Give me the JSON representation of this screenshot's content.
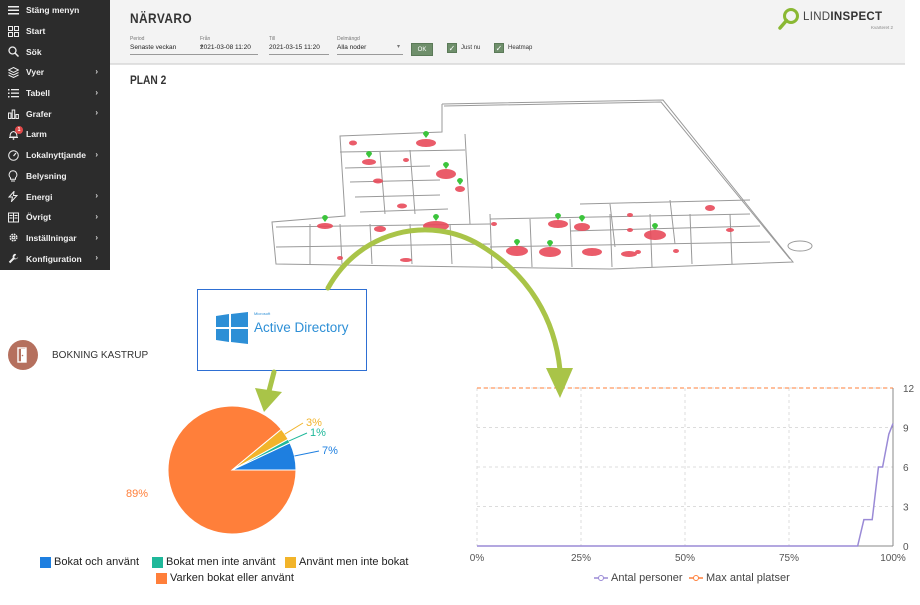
{
  "sidebar": {
    "items": [
      {
        "label": "Stäng menyn",
        "icon": "hamburger-icon",
        "chevron": false
      },
      {
        "label": "Start",
        "icon": "grid-icon",
        "chevron": false
      },
      {
        "label": "Sök",
        "icon": "search-icon",
        "chevron": false
      },
      {
        "label": "Vyer",
        "icon": "layers-icon",
        "chevron": true
      },
      {
        "label": "Tabell",
        "icon": "list-icon",
        "chevron": true
      },
      {
        "label": "Grafer",
        "icon": "bar-chart-icon",
        "chevron": true
      },
      {
        "label": "Larm",
        "icon": "bell-icon",
        "chevron": false,
        "badge": "1"
      },
      {
        "label": "Lokalnyttjande",
        "icon": "gauge-icon",
        "chevron": true
      },
      {
        "label": "Belysning",
        "icon": "lightbulb-icon",
        "chevron": false
      },
      {
        "label": "Energi",
        "icon": "lightning-icon",
        "chevron": true
      },
      {
        "label": "Övrigt",
        "icon": "book-icon",
        "chevron": true
      },
      {
        "label": "Inställningar",
        "icon": "gear-icon",
        "chevron": true
      },
      {
        "label": "Konfiguration",
        "icon": "wrench-icon",
        "chevron": true
      }
    ],
    "chevron_glyph": "›"
  },
  "header": {
    "title": "NÄRVARO",
    "period": {
      "label": "Period",
      "value": "Senaste veckan"
    },
    "from": {
      "label": "Från",
      "value": "2021-03-08 11:20"
    },
    "to": {
      "label": "Till",
      "value": "2021-03-15 11:20"
    },
    "subset": {
      "label": "Delmängd",
      "value": "Alla noder"
    },
    "ok_label": "OK",
    "just_nu": {
      "label": "Just nu",
      "checked": true
    },
    "heatmap": {
      "label": "Heatmap",
      "checked": true
    }
  },
  "logo": {
    "brand_light": "LIND",
    "brand_bold": "INSPECT",
    "sub": "Kvarteret 2"
  },
  "plan_title": "PLAN 2",
  "booking": {
    "title": "BOKNING KASTRUP"
  },
  "active_directory": {
    "small": "Microsoft",
    "label": "Active Directory"
  },
  "colors": {
    "sidebar_bg": "#2c2c2c",
    "accent_green": "#6f8f6b",
    "arrow_green": "#a9c448",
    "pie_blue": "#1e7fe0",
    "pie_teal": "#1fb89a",
    "pie_yellow": "#f2b42a",
    "pie_orange": "#ff7f3a",
    "line_purple": "#9a8ad6",
    "line_orange": "#ff7f3a"
  },
  "chart_data": [
    {
      "type": "pie",
      "title": "",
      "series": [
        {
          "name": "Bokat och använt",
          "value": 7,
          "label": "7%",
          "color": "#1e7fe0"
        },
        {
          "name": "Bokat men inte använt",
          "value": 1,
          "label": "1%",
          "color": "#1fb89a"
        },
        {
          "name": "Använt men inte bokat",
          "value": 3,
          "label": "3%",
          "color": "#f2b42a"
        },
        {
          "name": "Varken bokat eller använt",
          "value": 89,
          "label": "89%",
          "color": "#ff7f3a"
        }
      ]
    },
    {
      "type": "line",
      "title": "",
      "x_ticks": [
        "0%",
        "25%",
        "50%",
        "75%",
        "100%"
      ],
      "y_ticks": [
        "0",
        "3",
        "6",
        "9",
        "12"
      ],
      "xlim": [
        0,
        100
      ],
      "ylim": [
        0,
        12
      ],
      "y_axis_side": "right",
      "grid": true,
      "legend_placement": "bottom",
      "series": [
        {
          "name": "Antal personer",
          "color": "#9a8ad6",
          "x": [
            0,
            91.5,
            93,
            95,
            96.5,
            97.5,
            99,
            100
          ],
          "y": [
            0,
            0,
            2,
            2,
            6,
            6,
            8.5,
            9.3
          ]
        },
        {
          "name": "Max antal platser",
          "color": "#ff7f3a",
          "dashed": true,
          "x": [
            0,
            100
          ],
          "y": [
            12,
            12
          ]
        }
      ]
    }
  ]
}
